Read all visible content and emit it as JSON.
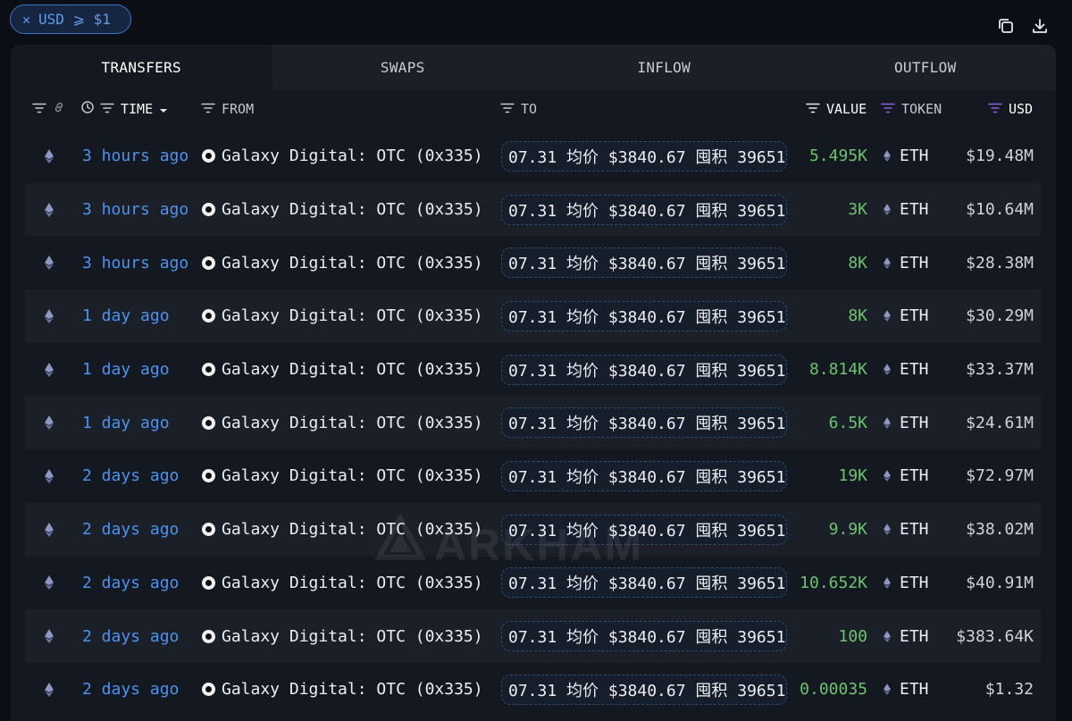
{
  "filter_chip": {
    "close_glyph": "✕",
    "label": "USD ⩾ $1"
  },
  "top_icons": [
    "copy-icon",
    "download-icon"
  ],
  "tabs": [
    {
      "label": "TRANSFERS",
      "active": true
    },
    {
      "label": "SWAPS",
      "active": false
    },
    {
      "label": "INFLOW",
      "active": false
    },
    {
      "label": "OUTFLOW",
      "active": false
    }
  ],
  "columns": {
    "time": "TIME",
    "from": "FROM",
    "to": "TO",
    "value": "VALUE",
    "token": "TOKEN",
    "usd": "USD"
  },
  "rows": [
    {
      "time": "3 hours ago",
      "from": "Galaxy Digital: OTC (0x335)",
      "to": "07.31 均价 $3840.67 囤积 39651.",
      "value": "5.495K",
      "token": "ETH",
      "usd": "$19.48M"
    },
    {
      "time": "3 hours ago",
      "from": "Galaxy Digital: OTC (0x335)",
      "to": "07.31 均价 $3840.67 囤积 39651.",
      "value": "3K",
      "token": "ETH",
      "usd": "$10.64M"
    },
    {
      "time": "3 hours ago",
      "from": "Galaxy Digital: OTC (0x335)",
      "to": "07.31 均价 $3840.67 囤积 39651.",
      "value": "8K",
      "token": "ETH",
      "usd": "$28.38M"
    },
    {
      "time": "1 day ago",
      "from": "Galaxy Digital: OTC (0x335)",
      "to": "07.31 均价 $3840.67 囤积 39651.",
      "value": "8K",
      "token": "ETH",
      "usd": "$30.29M"
    },
    {
      "time": "1 day ago",
      "from": "Galaxy Digital: OTC (0x335)",
      "to": "07.31 均价 $3840.67 囤积 39651.",
      "value": "8.814K",
      "token": "ETH",
      "usd": "$33.37M"
    },
    {
      "time": "1 day ago",
      "from": "Galaxy Digital: OTC (0x335)",
      "to": "07.31 均价 $3840.67 囤积 39651.",
      "value": "6.5K",
      "token": "ETH",
      "usd": "$24.61M"
    },
    {
      "time": "2 days ago",
      "from": "Galaxy Digital: OTC (0x335)",
      "to": "07.31 均价 $3840.67 囤积 39651.",
      "value": "19K",
      "token": "ETH",
      "usd": "$72.97M"
    },
    {
      "time": "2 days ago",
      "from": "Galaxy Digital: OTC (0x335)",
      "to": "07.31 均价 $3840.67 囤积 39651.",
      "value": "9.9K",
      "token": "ETH",
      "usd": "$38.02M"
    },
    {
      "time": "2 days ago",
      "from": "Galaxy Digital: OTC (0x335)",
      "to": "07.31 均价 $3840.67 囤积 39651.",
      "value": "10.652K",
      "token": "ETH",
      "usd": "$40.91M"
    },
    {
      "time": "2 days ago",
      "from": "Galaxy Digital: OTC (0x335)",
      "to": "07.31 均价 $3840.67 囤积 39651.",
      "value": "100",
      "token": "ETH",
      "usd": "$383.64K"
    },
    {
      "time": "2 days ago",
      "from": "Galaxy Digital: OTC (0x335)",
      "to": "07.31 均价 $3840.67 囤积 39651.",
      "value": "0.00035",
      "token": "ETH",
      "usd": "$1.32"
    }
  ],
  "watermark": "ARKHAM",
  "colors": {
    "time_link": "#4d92ee",
    "value_positive": "#6cc36e",
    "accent_filter": "#8a63e0",
    "chip_border": "#3a74c9"
  }
}
